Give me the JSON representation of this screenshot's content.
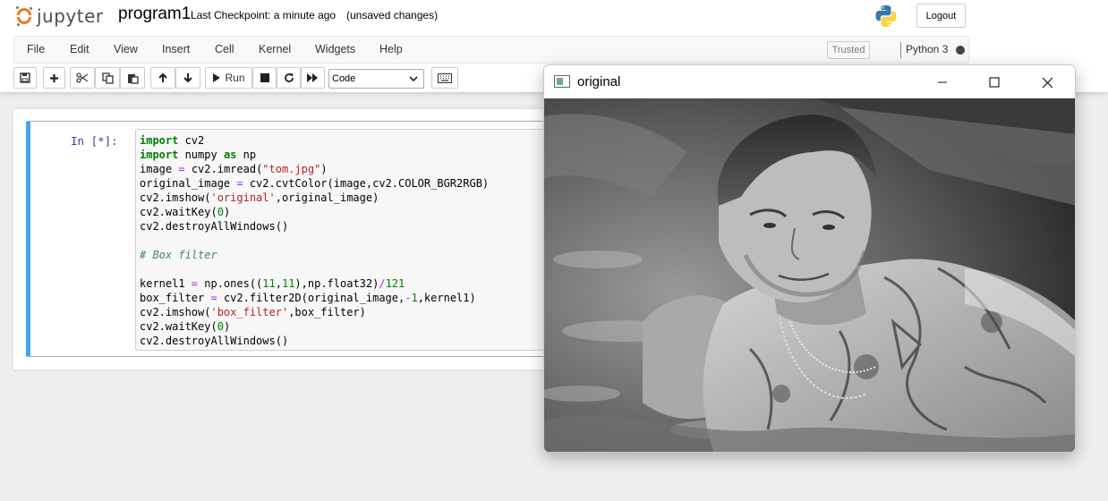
{
  "header": {
    "logo_text": "jupyter",
    "notebook_name": "program1",
    "checkpoint": "Last Checkpoint: a minute ago",
    "unsaved": "(unsaved changes)",
    "logout_label": "Logout",
    "logo_color": "#f37726"
  },
  "menubar": {
    "items": [
      "File",
      "Edit",
      "View",
      "Insert",
      "Cell",
      "Kernel",
      "Widgets",
      "Help"
    ],
    "trusted_label": "Trusted",
    "kernel_name": "Python 3"
  },
  "toolbar": {
    "run_label": "Run",
    "cell_type": "Code",
    "icons": [
      "save-icon",
      "plus-icon",
      "scissors-icon",
      "copy-icon",
      "paste-icon",
      "arrow-up-icon",
      "arrow-down-icon",
      "run-icon",
      "stop-icon",
      "restart-icon",
      "fast-forward-icon",
      "keyboard-icon"
    ]
  },
  "cell": {
    "prompt": "In [*]:",
    "accent_color": "#42a5f5",
    "code_lines": [
      "import cv2",
      "import numpy as np",
      "image = cv2.imread(\"tom.jpg\")",
      "original_image = cv2.cvtColor(image,cv2.COLOR_BGR2RGB)",
      "cv2.imshow('original',original_image)",
      "cv2.waitKey(0)",
      "cv2.destroyAllWindows()",
      "",
      "# Box filter",
      "",
      "kernel1 = np.ones((11,11),np.float32)/121",
      "box_filter = cv2.filter2D(original_image,-1,kernel1)",
      "cv2.imshow('box_filter',box_filter)",
      "cv2.waitKey(0)",
      "cv2.destroyAllWindows()"
    ]
  },
  "cv_window": {
    "title": "original",
    "controls": [
      "minimize-icon",
      "maximize-icon",
      "close-icon"
    ]
  }
}
